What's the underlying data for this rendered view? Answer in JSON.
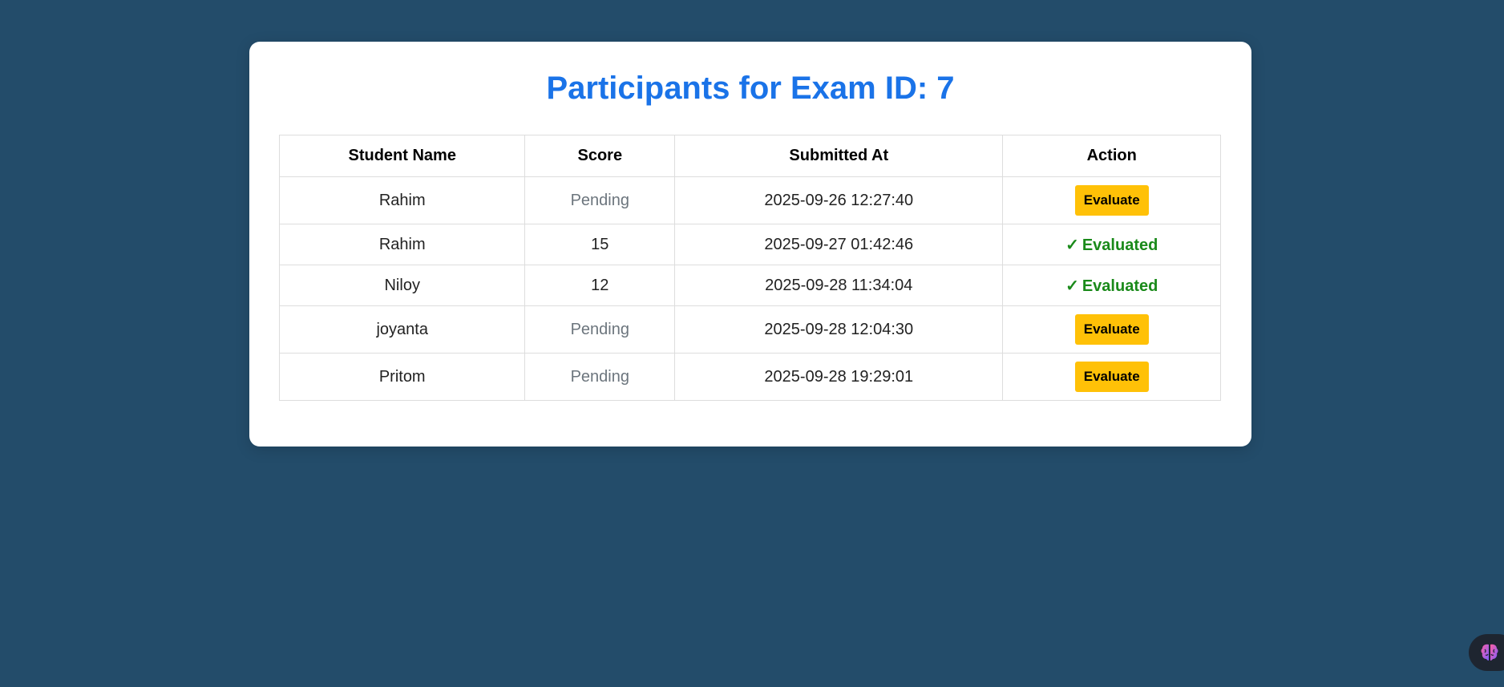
{
  "page": {
    "title": "Participants for Exam ID: 7"
  },
  "table": {
    "headers": [
      "Student Name",
      "Score",
      "Submitted At",
      "Action"
    ],
    "rows": [
      {
        "name": "Rahim",
        "score": "Pending",
        "submitted_at": "2025-09-26 12:27:40",
        "action": "Evaluate",
        "status": "pending"
      },
      {
        "name": "Rahim",
        "score": "15",
        "submitted_at": "2025-09-27 01:42:46",
        "action": "Evaluated",
        "status": "evaluated"
      },
      {
        "name": "Niloy",
        "score": "12",
        "submitted_at": "2025-09-28 11:34:04",
        "action": "Evaluated",
        "status": "evaluated"
      },
      {
        "name": "joyanta",
        "score": "Pending",
        "submitted_at": "2025-09-28 12:04:30",
        "action": "Evaluate",
        "status": "pending"
      },
      {
        "name": "Pritom",
        "score": "Pending",
        "submitted_at": "2025-09-28 19:29:01",
        "action": "Evaluate",
        "status": "pending"
      }
    ],
    "check_glyph": "✓"
  },
  "colors": {
    "background": "#234c6a",
    "title": "#1a73e8",
    "evaluate_button": "#ffc107",
    "evaluated_text": "#1a8a1a",
    "pending_text": "#6c757d"
  },
  "icons": {
    "extension": "brain-icon"
  }
}
